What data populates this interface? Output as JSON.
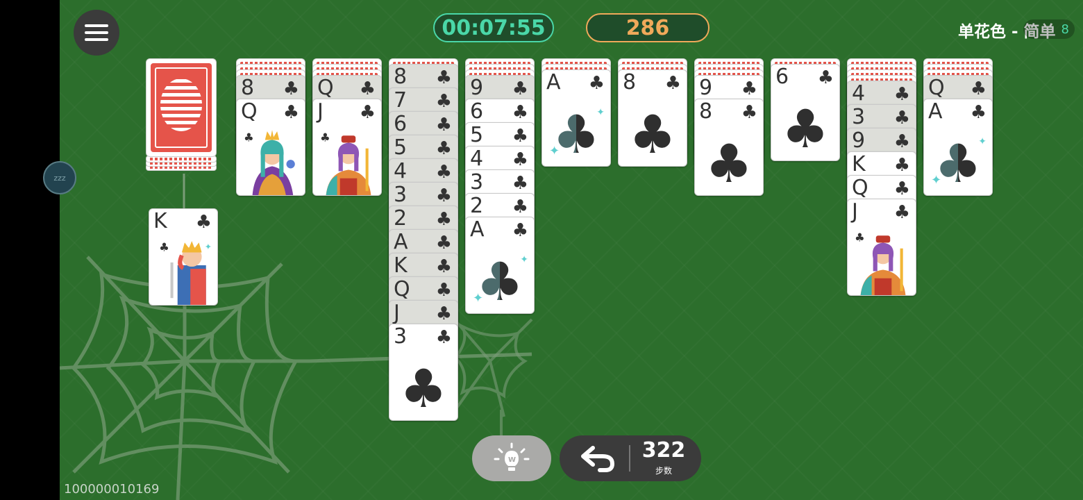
{
  "header": {
    "timer": "00:07:55",
    "score": "286",
    "mode_title": "单花色 - 简单",
    "mode_badge": "8"
  },
  "sleep_indicator": "zzz",
  "stock": {
    "remaining_deals": 4
  },
  "foundation_top": {
    "rank": "K",
    "suit": "♣"
  },
  "columns": [
    {
      "hidden": 3,
      "visible": [
        {
          "rank": "8",
          "suit": "♣",
          "faded": true
        },
        {
          "rank": "Q",
          "suit": "♣",
          "face": "queen"
        }
      ]
    },
    {
      "hidden": 3,
      "visible": [
        {
          "rank": "Q",
          "suit": "♣",
          "faded": true
        },
        {
          "rank": "J",
          "suit": "♣",
          "face": "jack"
        }
      ]
    },
    {
      "hidden": 1,
      "visible": [
        {
          "rank": "8",
          "suit": "♣",
          "faded": true
        },
        {
          "rank": "7",
          "suit": "♣",
          "faded": true
        },
        {
          "rank": "6",
          "suit": "♣",
          "faded": true
        },
        {
          "rank": "5",
          "suit": "♣",
          "faded": true
        },
        {
          "rank": "4",
          "suit": "♣",
          "faded": true
        },
        {
          "rank": "3",
          "suit": "♣",
          "faded": true
        },
        {
          "rank": "2",
          "suit": "♣",
          "faded": true
        },
        {
          "rank": "A",
          "suit": "♣",
          "faded": true
        },
        {
          "rank": "K",
          "suit": "♣",
          "faded": true
        },
        {
          "rank": "Q",
          "suit": "♣",
          "faded": true
        },
        {
          "rank": "J",
          "suit": "♣",
          "faded": true
        },
        {
          "rank": "3",
          "suit": "♣"
        }
      ]
    },
    {
      "hidden": 3,
      "visible": [
        {
          "rank": "9",
          "suit": "♣",
          "faded": true
        },
        {
          "rank": "6",
          "suit": "♣"
        },
        {
          "rank": "5",
          "suit": "♣"
        },
        {
          "rank": "4",
          "suit": "♣"
        },
        {
          "rank": "3",
          "suit": "♣"
        },
        {
          "rank": "2",
          "suit": "♣"
        },
        {
          "rank": "A",
          "suit": "♣"
        }
      ]
    },
    {
      "hidden": 2,
      "visible": [
        {
          "rank": "A",
          "suit": "♣"
        }
      ]
    },
    {
      "hidden": 2,
      "visible": [
        {
          "rank": "8",
          "suit": "♣"
        }
      ]
    },
    {
      "hidden": 3,
      "visible": [
        {
          "rank": "9",
          "suit": "♣"
        },
        {
          "rank": "8",
          "suit": "♣"
        }
      ]
    },
    {
      "hidden": 1,
      "visible": [
        {
          "rank": "6",
          "suit": "♣"
        }
      ]
    },
    {
      "hidden": 4,
      "visible": [
        {
          "rank": "4",
          "suit": "♣",
          "faded": true
        },
        {
          "rank": "3",
          "suit": "♣",
          "faded": true
        },
        {
          "rank": "9",
          "suit": "♣",
          "faded": true
        },
        {
          "rank": "K",
          "suit": "♣"
        },
        {
          "rank": "Q",
          "suit": "♣"
        },
        {
          "rank": "J",
          "suit": "♣",
          "face": "jack"
        }
      ]
    },
    {
      "hidden": 3,
      "visible": [
        {
          "rank": "Q",
          "suit": "♣",
          "faded": true
        },
        {
          "rank": "A",
          "suit": "♣"
        }
      ]
    }
  ],
  "controls": {
    "moves": "322",
    "moves_label": "步数"
  },
  "game_id": "100000010169",
  "colors": {
    "table": "#2c6e2c",
    "timer": "#4ad7a8",
    "score": "#f0a95a"
  }
}
